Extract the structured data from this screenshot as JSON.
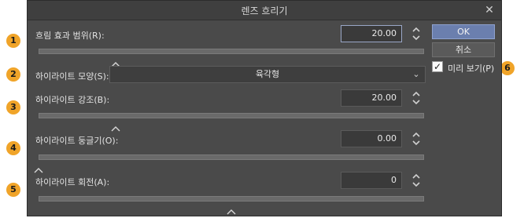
{
  "window": {
    "title": "렌즈 흐리기",
    "close_glyph": "✕"
  },
  "rows": [
    {
      "key": "blur_range",
      "label": "흐림 효과 범위(R):",
      "value": "20.00",
      "level": 0.2
    },
    {
      "key": "highlight_shape",
      "label": "하이라이트 모양(S):",
      "select_value": "육각형"
    },
    {
      "key": "highlight_strength",
      "label": "하이라이트 강조(B):",
      "value": "20.00",
      "level": 0.2
    },
    {
      "key": "highlight_roundness",
      "label": "하이라이트 둥글기(O):",
      "value": "0.00",
      "level": 0.0
    },
    {
      "key": "highlight_rotation",
      "label": "하이라이트 회전(A):",
      "value": "0",
      "level": 0.5
    }
  ],
  "buttons": {
    "ok_label": "OK",
    "cancel_label": "취소"
  },
  "preview": {
    "label": "미리 보기(P)",
    "checked": true
  },
  "callouts": [
    "1",
    "2",
    "3",
    "4",
    "5",
    "6"
  ],
  "colors": {
    "dialog_bg": "#4a4a4a",
    "ok_button": "#6b7fae",
    "callout": "#f0a429"
  },
  "icons": {
    "close": "close-icon",
    "spin": "spinner-arrows-icon",
    "dropdown": "chevron-down-icon",
    "thumb": "slider-thumb-icon",
    "check": "checkmark-icon"
  }
}
